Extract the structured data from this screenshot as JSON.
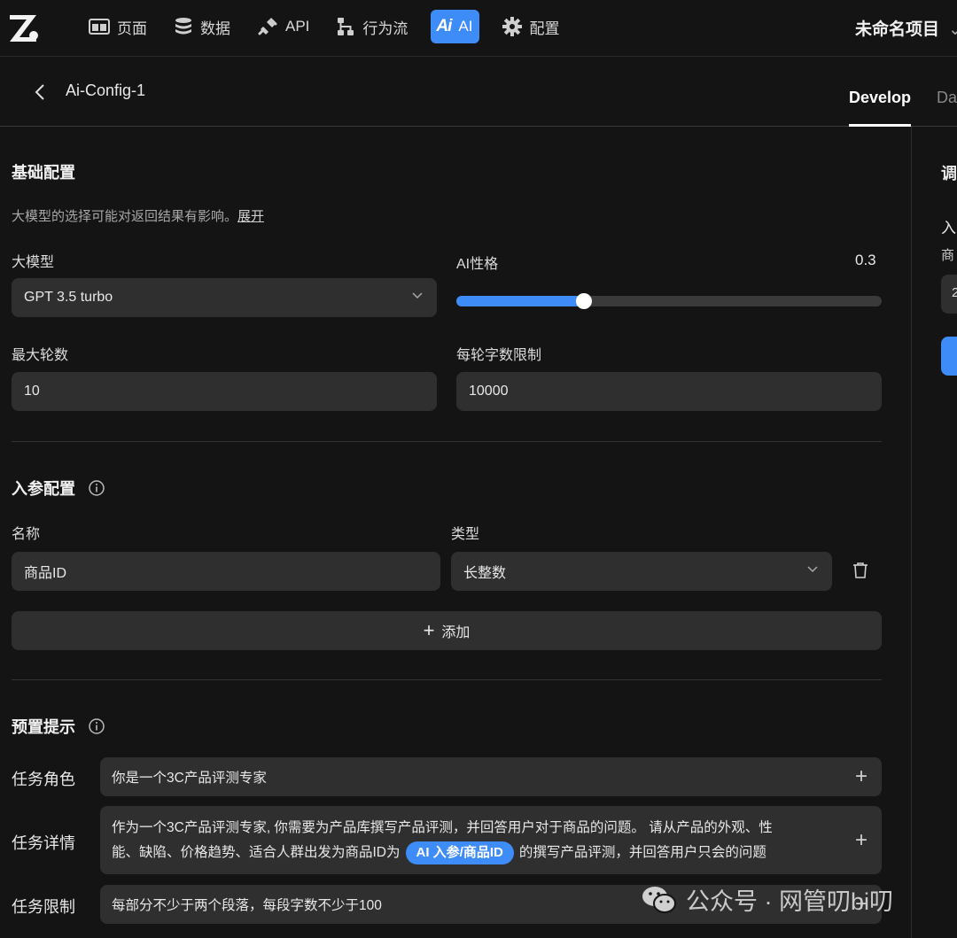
{
  "nav": {
    "items": [
      {
        "label": "页面",
        "icon": "page-icon"
      },
      {
        "label": "数据",
        "icon": "database-icon"
      },
      {
        "label": "API",
        "icon": "api-icon"
      },
      {
        "label": "行为流",
        "icon": "flow-icon"
      },
      {
        "label": "AI",
        "icon": "ai-icon",
        "badge": "Ai",
        "active": true
      },
      {
        "label": "配置",
        "icon": "gear-icon"
      }
    ],
    "project": "未命名项目"
  },
  "subheader": {
    "title": "Ai-Config-1",
    "tabs": [
      "Develop",
      "Da"
    ]
  },
  "basic": {
    "title": "基础配置",
    "desc": "大模型的选择可能对返回结果有影响。",
    "expand": "展开",
    "model_label": "大模型",
    "model_value": "GPT 3.5 turbo",
    "personality_label": "AI性格",
    "personality_value": "0.3",
    "personality_fraction": 0.3,
    "max_rounds_label": "最大轮数",
    "max_rounds_value": "10",
    "char_limit_label": "每轮字数限制",
    "char_limit_value": "10000"
  },
  "params": {
    "title": "入参配置",
    "name_label": "名称",
    "type_label": "类型",
    "rows": [
      {
        "name": "商品ID",
        "type": "长整数"
      }
    ],
    "add_label": "添加"
  },
  "prompt": {
    "title": "预置提示",
    "role_label": "任务角色",
    "role_value": "你是一个3C产品评测专家",
    "detail_label": "任务详情",
    "detail_line1": "作为一个3C产品评测专家, 你需要为产品库撰写产品评测，并回答用户对于商品的问题。 请从产品的外观、性",
    "detail_line2a": "能、缺陷、价格趋势、适合人群出发为商品ID为",
    "detail_chip": "AI 入参/商品ID",
    "detail_line2b": "的撰写产品评测，并回答用户只会的问题",
    "limit_label": "任务限制",
    "limit_value": "每部分不少于两个段落，每段字数不少于100"
  },
  "right_panel": {
    "title": "调",
    "sub": "入",
    "field_label": "商",
    "field_value": "2"
  },
  "watermark": "公众号 · 网管叨bi叨",
  "colors": {
    "accent": "#3e8cf7",
    "background": "#141414",
    "field": "#2f2f2f"
  }
}
